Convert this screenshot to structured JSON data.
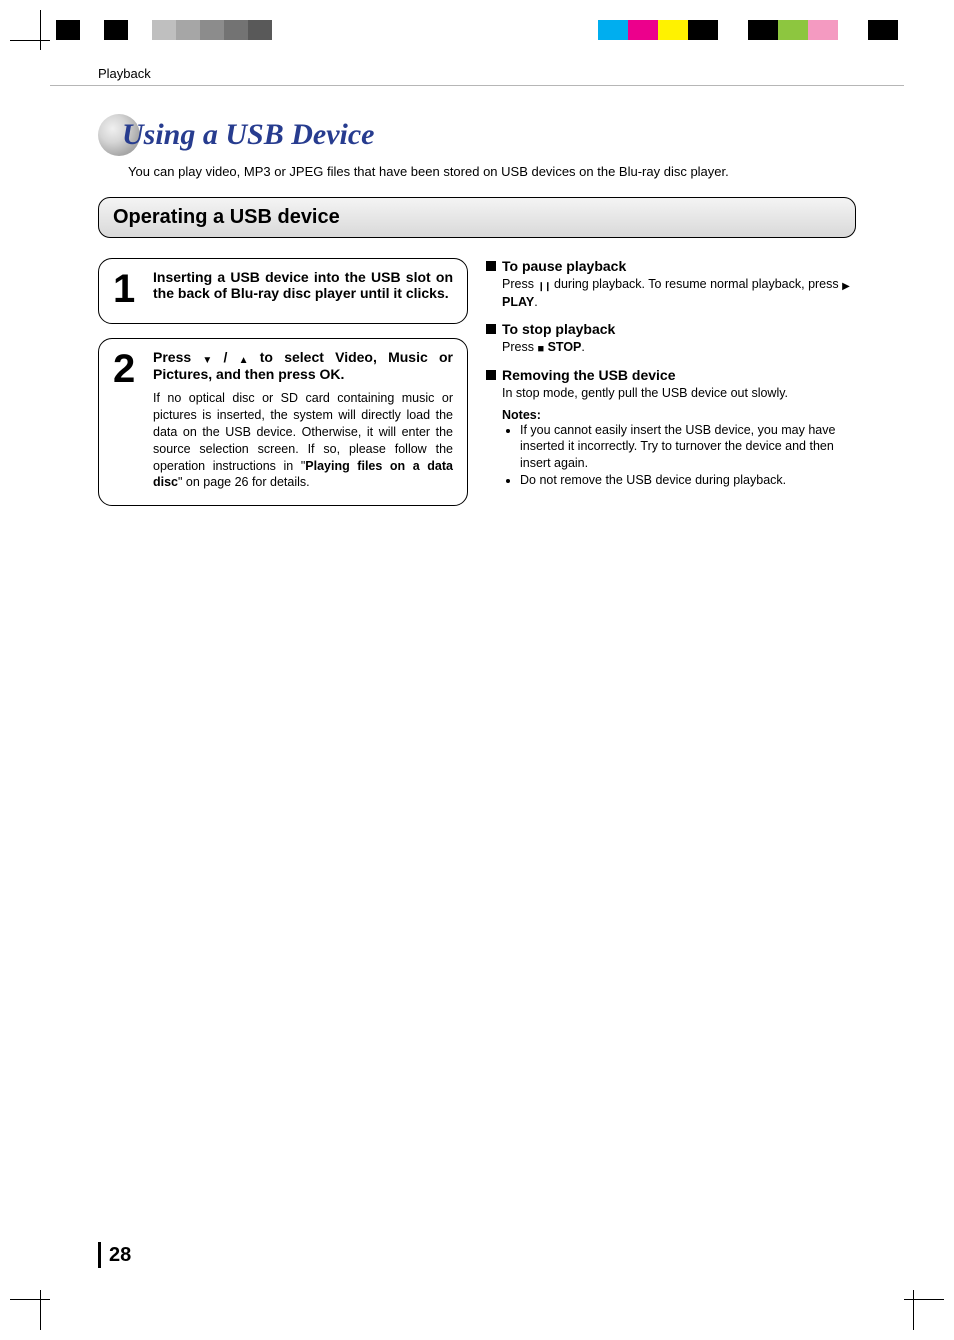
{
  "registration_colors_left": [
    "#000000",
    "#ffffff",
    "#000000",
    "#ffffff",
    "#bfbfbf",
    "#a6a6a6",
    "#8c8c8c",
    "#737373",
    "#595959",
    "#ffffff"
  ],
  "registration_colors_right": [
    "#00aeef",
    "#ec008c",
    "#fff200",
    "#000000",
    "#ffffff",
    "#000000",
    "#8dc63f",
    "#f49ac1",
    "#ffffff",
    "#000000"
  ],
  "section_label": "Playback",
  "heading": "Using a USB Device",
  "intro": "You can play video, MP3 or JPEG files that have been stored on USB devices on the Blu-ray disc player.",
  "subheading": "Operating a USB device",
  "steps": [
    {
      "num": "1",
      "title": "Inserting a USB device into the USB slot on the back of Blu-ray disc player until it clicks.",
      "body": ""
    },
    {
      "num": "2",
      "title_pre": "Press ",
      "title_mid": " to select Video, Music or Pictures, and then press OK.",
      "body_pre": "If no optical disc or SD card containing music or pictures is inserted, the system will directly load the data on the USB device. Otherwise, it will enter the source selection screen. If so, please follow the operation instructions in \"",
      "body_bold": "Playing files on a data disc",
      "body_post": "\" on page 26 for details."
    }
  ],
  "info": {
    "pause": {
      "title": "To pause playback",
      "body_pre": "Press ",
      "body_mid": " during playback. To resume normal playback, press ",
      "play_label": "PLAY",
      "body_post": "."
    },
    "stop": {
      "title": "To stop playback",
      "body_pre": "Press ",
      "stop_label": "STOP",
      "body_post": "."
    },
    "remove": {
      "title": "Removing the USB device",
      "body": "In stop mode, gently pull the USB device out slowly."
    },
    "notes_title": "Notes:",
    "notes": [
      "If you cannot easily insert the USB device, you may have inserted it incorrectly. Try to turnover the device and then insert again.",
      "Do not remove the USB device during playback."
    ]
  },
  "page_number": "28"
}
